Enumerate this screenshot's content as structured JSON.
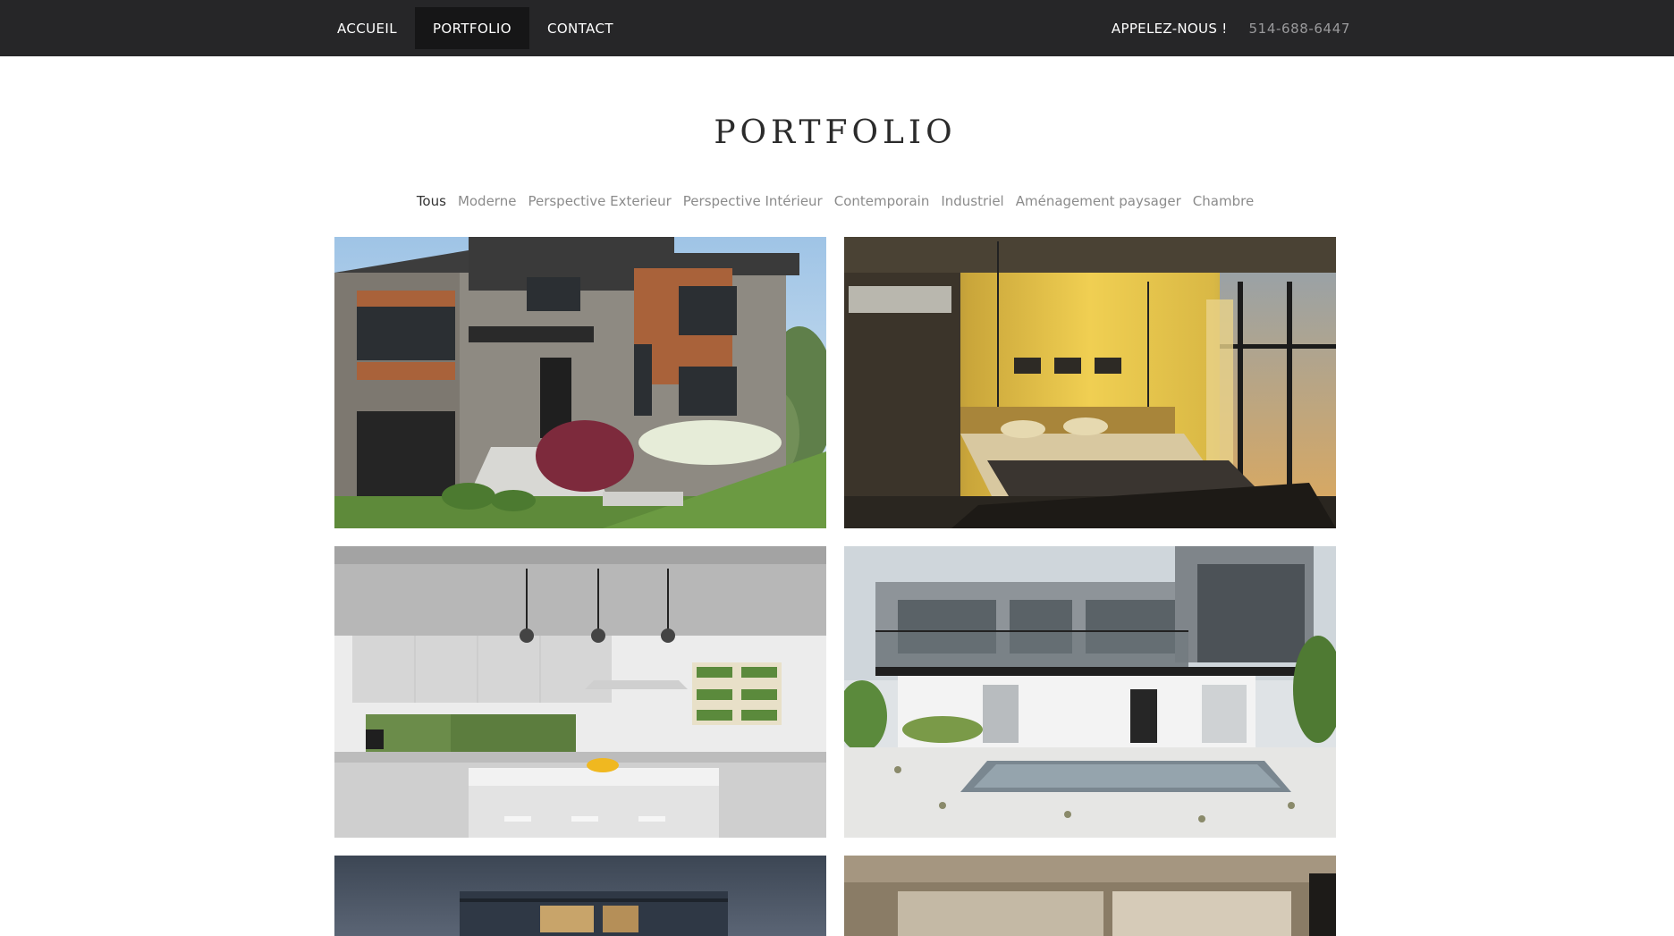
{
  "nav": {
    "items": [
      {
        "label": "ACCUEIL",
        "active": false
      },
      {
        "label": "PORTFOLIO",
        "active": true
      },
      {
        "label": "CONTACT",
        "active": false
      }
    ],
    "call_label": "APPELEZ-NOUS !",
    "phone": "514-688-6447"
  },
  "page": {
    "title": "PORTFOLIO"
  },
  "filters": {
    "items": [
      {
        "label": "Tous",
        "active": true
      },
      {
        "label": "Moderne",
        "active": false
      },
      {
        "label": "Perspective Exterieur",
        "active": false
      },
      {
        "label": "Perspective Intérieur",
        "active": false
      },
      {
        "label": "Contemporain",
        "active": false
      },
      {
        "label": "Industriel",
        "active": false
      },
      {
        "label": "Aménagement paysager",
        "active": false
      },
      {
        "label": "Chambre",
        "active": false
      }
    ]
  },
  "gallery": {
    "tiles": [
      {
        "subject": "modern-house-exterior-day"
      },
      {
        "subject": "bedroom-interior-warm-light"
      },
      {
        "subject": "white-kitchen-interior"
      },
      {
        "subject": "modern-house-with-pool"
      },
      {
        "subject": "house-exterior-dusk"
      },
      {
        "subject": "interior-loft"
      }
    ]
  },
  "colors": {
    "nav_bg": "#262628",
    "nav_active_bg": "#161617",
    "filter_inactive": "#8b8b8b",
    "filter_active": "#333333",
    "title": "#2b2b2b"
  }
}
